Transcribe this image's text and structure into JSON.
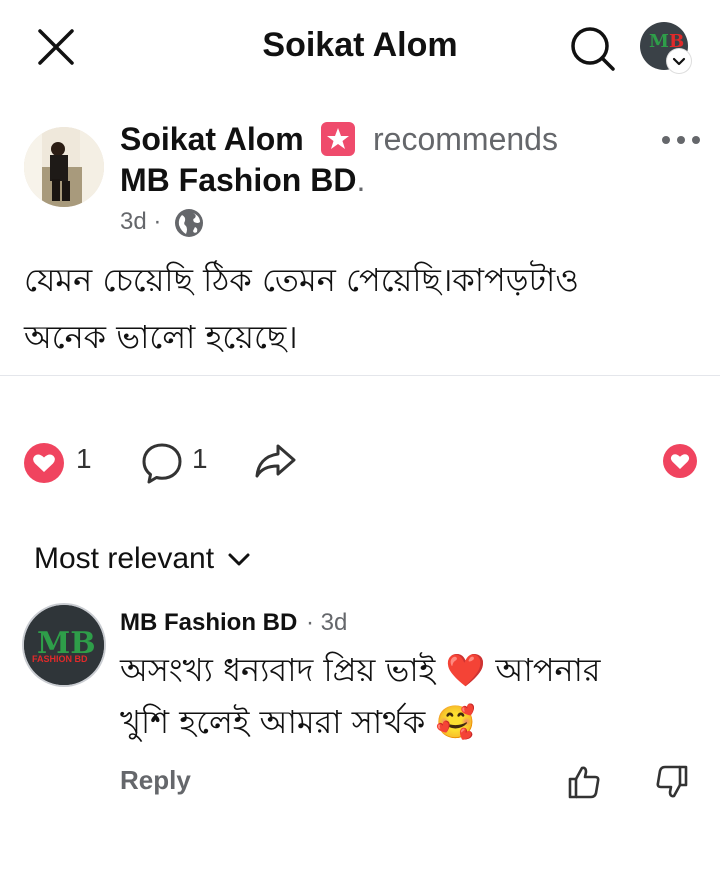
{
  "header": {
    "title": "Soikat Alom",
    "avatar_text": "MB"
  },
  "post": {
    "author": "Soikat Alom",
    "action": "recommends",
    "page": "MB Fashion BD",
    "page_suffix": ".",
    "time": "3d ·",
    "text_line1": "যেমন চেয়েছি ঠিক তেমন পেয়েছি।কাপড়টাও",
    "text_line2": "অনেক ভালো হয়েছে।"
  },
  "actions": {
    "reaction_count": "1",
    "comment_count": "1"
  },
  "comments": {
    "sort_label": "Most relevant",
    "items": [
      {
        "author": "MB Fashion BD",
        "time": "· 3d",
        "avatar_text": "MB",
        "avatar_subtext": "FASHION BD",
        "text_line1_a": "অসংখ্য ধন্যবাদ প্রিয় ভাই ",
        "emoji1": "❤️",
        "text_line1_b": " আপনার",
        "text_line2": "খুশি হলেই আমরা সার্থক ",
        "emoji2": "🥰",
        "reply_label": "Reply"
      }
    ]
  },
  "colors": {
    "heart": "#f02849",
    "secondary_text": "#65676b",
    "badge": "#ef4b6c",
    "mb_green": "#2e9e49",
    "mb_red": "#e02a2a"
  },
  "icons": [
    "close-icon",
    "search-icon",
    "chevron-down-icon",
    "star-badge-icon",
    "more-icon",
    "globe-icon",
    "heart-icon",
    "comment-icon",
    "share-icon",
    "thumb-up-icon",
    "thumb-down-icon"
  ]
}
